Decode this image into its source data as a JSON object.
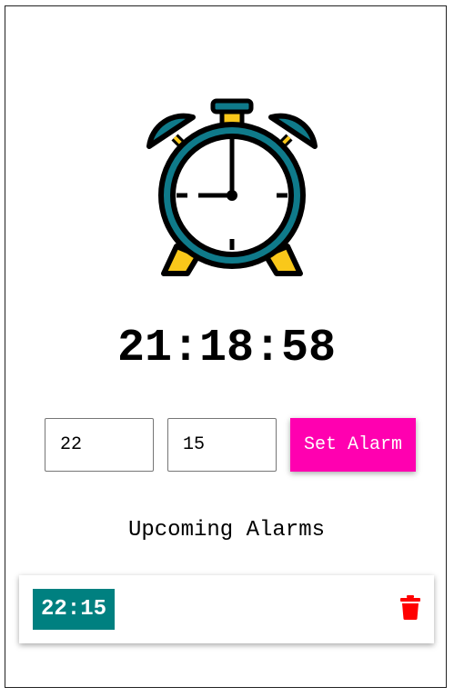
{
  "clock": {
    "icon": "alarm-clock-icon",
    "current_time": "21:18:58"
  },
  "form": {
    "hour_value": "22",
    "minute_value": "15",
    "set_button_label": "Set Alarm",
    "button_color": "#ff00b0"
  },
  "alarms": {
    "title": "Upcoming Alarms",
    "items": [
      {
        "time": "22:15",
        "delete_icon": "trash-icon"
      }
    ],
    "badge_color": "#008080",
    "delete_color": "#ff0000"
  }
}
